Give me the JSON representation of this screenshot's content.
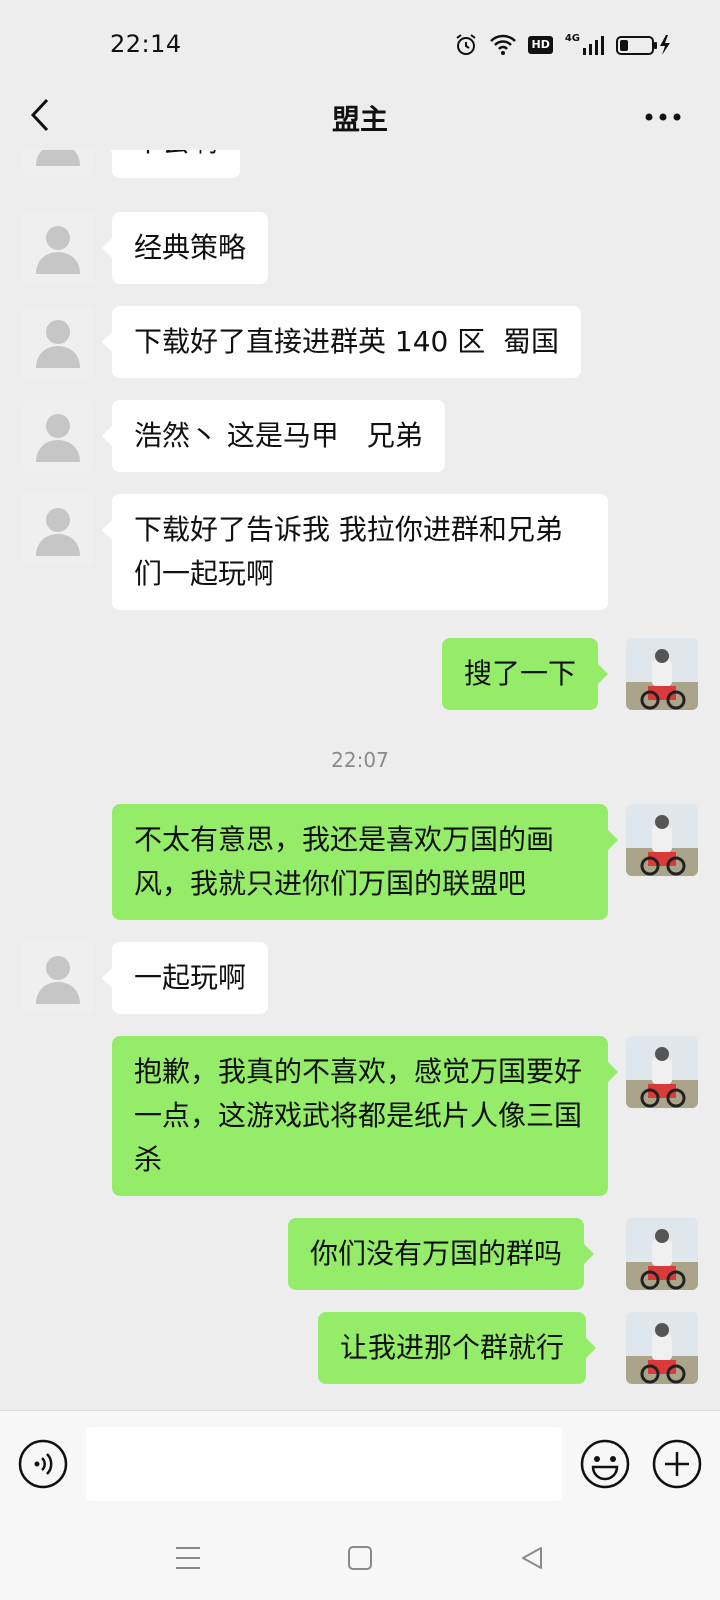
{
  "status_bar": {
    "time": "22:14",
    "icons": [
      "alarm-icon",
      "wifi-icon",
      "hd-badge",
      "4g-signal-icon",
      "battery-charging-icon"
    ],
    "hd_label": "HD",
    "network_label": "4G"
  },
  "header": {
    "title": "盟主",
    "back_icon": "chevron-left-icon",
    "more_icon": "more-dots-icon"
  },
  "messages": [
    {
      "side": "in",
      "text": "不会啊"
    },
    {
      "side": "in",
      "text": "经典策略"
    },
    {
      "side": "in",
      "text": "下载好了直接进群英 140 区  蜀国"
    },
    {
      "side": "in",
      "text": "浩然丶 这是马甲　兄弟"
    },
    {
      "side": "in",
      "text": "下载好了告诉我 我拉你进群和兄弟们一起玩啊"
    },
    {
      "side": "out",
      "text": "搜了一下"
    },
    {
      "side": "time",
      "text": "22:07"
    },
    {
      "side": "out",
      "text": "不太有意思，我还是喜欢万国的画风，我就只进你们万国的联盟吧"
    },
    {
      "side": "in",
      "text": "一起玩啊"
    },
    {
      "side": "out",
      "text": "抱歉，我真的不喜欢，感觉万国要好一点，这游戏武将都是纸片人像三国杀"
    },
    {
      "side": "out",
      "text": "你们没有万国的群吗"
    },
    {
      "side": "out",
      "text": "让我进那个群就行"
    }
  ],
  "input_bar": {
    "voice_icon": "voice-icon",
    "placeholder": "",
    "emoji_icon": "emoji-icon",
    "plus_icon": "plus-icon"
  },
  "nav_bar": {
    "icons": [
      "menu-icon",
      "home-icon",
      "back-triangle-icon"
    ]
  },
  "colors": {
    "background": "#ededed",
    "incoming_bubble": "#ffffff",
    "outgoing_bubble": "#95ec69",
    "timestamp": "#8a8a8a"
  }
}
